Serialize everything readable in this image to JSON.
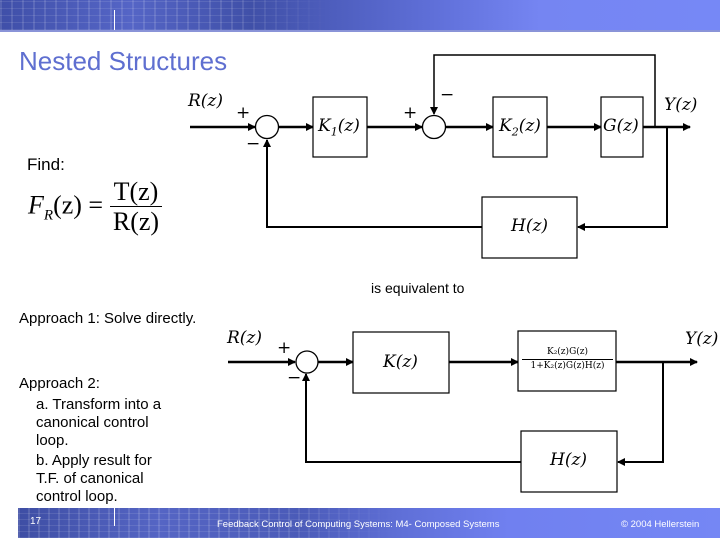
{
  "slide": {
    "title": "Nested Structures",
    "find_label": "Find:",
    "formula": {
      "lhs": "F",
      "lhs_sub": "R",
      "lhs_arg": "(z) =",
      "numerator": "T(z)",
      "denominator": "R(z)"
    },
    "equivalence_label": "is equivalent to",
    "approach1": "Approach 1: Solve directly.",
    "approach2": {
      "heading": "Approach 2:",
      "step_a_lines": [
        "a. Transform into a",
        "canonical control",
        "loop."
      ],
      "step_b_lines": [
        "b. Apply result for",
        "T.F. of canonical",
        "control loop."
      ]
    }
  },
  "diagram_top": {
    "input_label": "R(z)",
    "output_label": "Y(z)",
    "blocks": {
      "k1": "K",
      "k1_sub": "1",
      "k1_arg": "(z)",
      "k2": "K",
      "k2_sub": "2",
      "k2_arg": "(z)",
      "g": "G(z)",
      "h": "H(z)"
    },
    "signs": {
      "sum1_plus": "+",
      "sum1_minus": "−",
      "sum2_plus": "+",
      "sum2_minus": "−"
    }
  },
  "diagram_bottom": {
    "input_label": "R(z)",
    "output_label": "Y(z)",
    "blocks": {
      "k": "K(z)",
      "tf_numerator": "K₂(z)G(z)",
      "tf_denominator": "1+K₂(z)G(z)H(z)",
      "h": "H(z)"
    },
    "signs": {
      "sum_plus": "+",
      "sum_minus": "−"
    }
  },
  "footer": {
    "page_number": "17",
    "course_title": "Feedback Control of Computing Systems: M4- Composed Systems",
    "copyright": "© 2004 Hellerstein"
  }
}
